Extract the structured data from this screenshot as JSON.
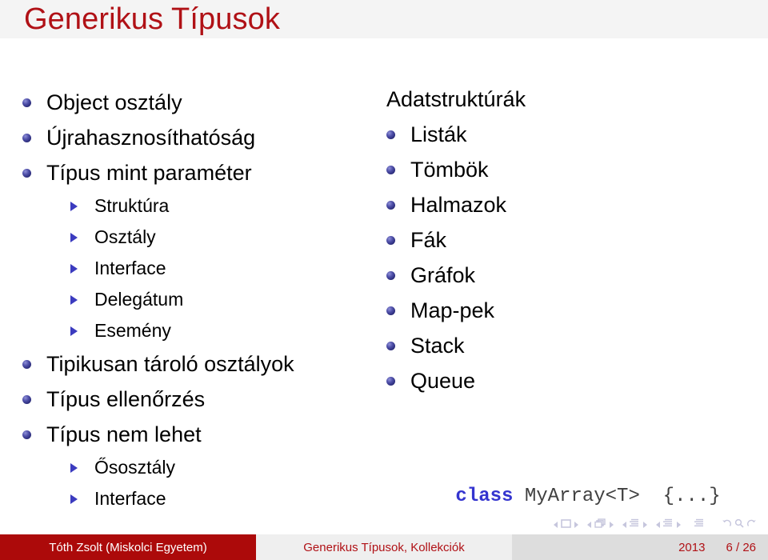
{
  "header": {
    "title": "Generikus Típusok",
    "band_color": "#f4f4f4",
    "title_color": "#b01116"
  },
  "colors": {
    "title_red": "#b01116",
    "footer_red": "#ac0a0a",
    "bullet_blue": "#2e2f7e",
    "triangle_blue": "#3b3bbf",
    "code_keyword_blue": "#3434cf",
    "nav_lavender": "#c6c6dd"
  },
  "left_column": {
    "items": [
      {
        "level": 1,
        "marker": "ball-bullet",
        "label": "Object osztály"
      },
      {
        "level": 1,
        "marker": "ball-bullet",
        "label": "Újrahasznosíthatóság"
      },
      {
        "level": 1,
        "marker": "ball-bullet",
        "label": "Típus mint paraméter"
      },
      {
        "level": 2,
        "marker": "triangle-bullet",
        "label": "Struktúra"
      },
      {
        "level": 2,
        "marker": "triangle-bullet",
        "label": "Osztály"
      },
      {
        "level": 2,
        "marker": "triangle-bullet",
        "label": "Interface"
      },
      {
        "level": 2,
        "marker": "triangle-bullet",
        "label": "Delegátum"
      },
      {
        "level": 2,
        "marker": "triangle-bullet",
        "label": "Esemény"
      },
      {
        "level": 1,
        "marker": "ball-bullet",
        "label": "Tipikusan tároló osztályok"
      },
      {
        "level": 1,
        "marker": "ball-bullet",
        "label": "Típus ellenőrzés"
      },
      {
        "level": 1,
        "marker": "ball-bullet",
        "label": "Típus nem lehet"
      },
      {
        "level": 2,
        "marker": "triangle-bullet",
        "label": "Ősosztály"
      },
      {
        "level": 2,
        "marker": "triangle-bullet",
        "label": "Interface"
      }
    ]
  },
  "right_column": {
    "heading": "Adatstruktúrák",
    "items": [
      {
        "level": 1,
        "marker": "ball-bullet",
        "label": "Listák"
      },
      {
        "level": 1,
        "marker": "ball-bullet",
        "label": "Tömbök"
      },
      {
        "level": 1,
        "marker": "ball-bullet",
        "label": "Halmazok"
      },
      {
        "level": 1,
        "marker": "ball-bullet",
        "label": "Fák"
      },
      {
        "level": 1,
        "marker": "ball-bullet",
        "label": "Gráfok"
      },
      {
        "level": 1,
        "marker": "ball-bullet",
        "label": "Map-pek"
      },
      {
        "level": 1,
        "marker": "ball-bullet",
        "label": "Stack"
      },
      {
        "level": 1,
        "marker": "ball-bullet",
        "label": "Queue"
      }
    ],
    "code": {
      "keyword": "class",
      "rest": " MyArray<T>  {...}"
    }
  },
  "navigation": {
    "icons": [
      "prev-slide-arrow",
      "slide-icon",
      "next-slide-arrow",
      "prev-frame-arrow",
      "frame-icon",
      "next-frame-arrow",
      "prev-subsection-arrow",
      "subsection-icon",
      "next-subsection-arrow",
      "prev-section-arrow",
      "section-icon",
      "next-section-arrow",
      "document-icon",
      "back-icon",
      "search-icon",
      "forward-icon"
    ]
  },
  "footer": {
    "author": "Tóth Zsolt  (Miskolci Egyetem)",
    "subject": "Generikus Típusok, Kollekciók",
    "year": "2013",
    "page": "6 / 26"
  }
}
